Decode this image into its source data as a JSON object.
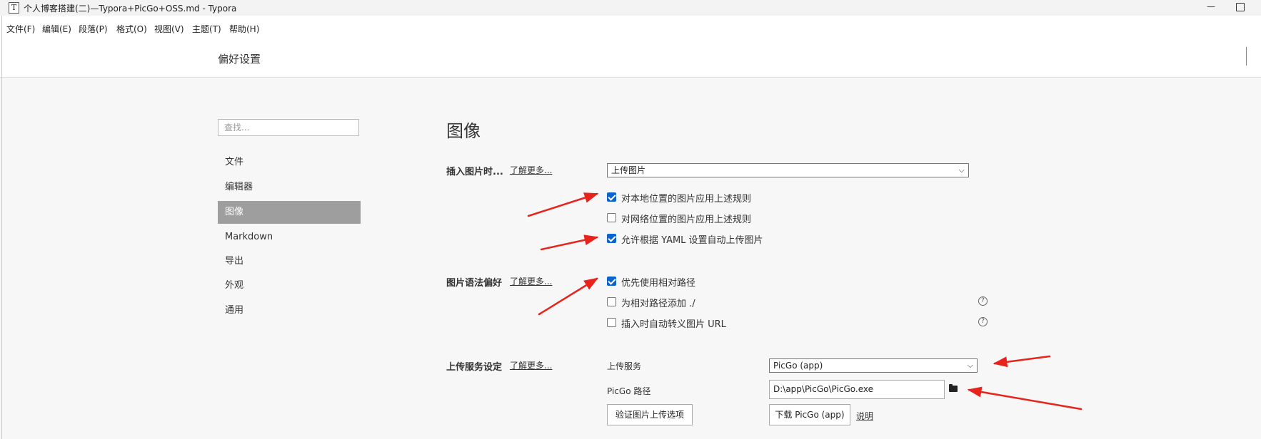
{
  "window": {
    "title": "个人博客搭建(二)—Typora+PicGo+OSS.md - Typora",
    "app_icon_letter": "T",
    "minimize_glyph": "—"
  },
  "menubar": {
    "items": [
      "文件(F)",
      "编辑(E)",
      "段落(P)",
      "格式(O)",
      "视图(V)",
      "主题(T)",
      "帮助(H)"
    ]
  },
  "header": {
    "title": "偏好设置"
  },
  "sidebar": {
    "search_placeholder": "查找...",
    "items": [
      "文件",
      "编辑器",
      "图像",
      "Markdown",
      "导出",
      "外观",
      "通用"
    ],
    "active_index": 2
  },
  "main": {
    "section_title": "图像",
    "insert_image": {
      "label": "插入图片时...",
      "learn_more": "了解更多...",
      "select_value": "上传图片",
      "options": [
        {
          "label": "对本地位置的图片应用上述规则",
          "checked": true
        },
        {
          "label": "对网络位置的图片应用上述规则",
          "checked": false
        },
        {
          "label": "允许根据 YAML 设置自动上传图片",
          "checked": true
        }
      ]
    },
    "image_syntax": {
      "label": "图片语法偏好",
      "learn_more": "了解更多...",
      "options": [
        {
          "label": "优先使用相对路径",
          "checked": true,
          "help": false
        },
        {
          "label": "为相对路径添加 ./",
          "checked": false,
          "help": true
        },
        {
          "label": "插入时自动转义图片 URL",
          "checked": false,
          "help": true
        }
      ],
      "help_glyph": "?"
    },
    "upload_service": {
      "label": "上传服务设定",
      "learn_more": "了解更多...",
      "service_label": "上传服务",
      "service_value": "PicGo (app)",
      "path_label": "PicGo 路径",
      "path_value": "D:\\app\\PicGo\\PicGo.exe",
      "verify_button": "验证图片上传选项",
      "download_button": "下载 PicGo (app)",
      "help_link": "说明"
    }
  },
  "colors": {
    "checkbox_checked": "#0b63ce",
    "sidebar_active": "#9e9e9e",
    "annotation_arrow": "#e8231b"
  }
}
